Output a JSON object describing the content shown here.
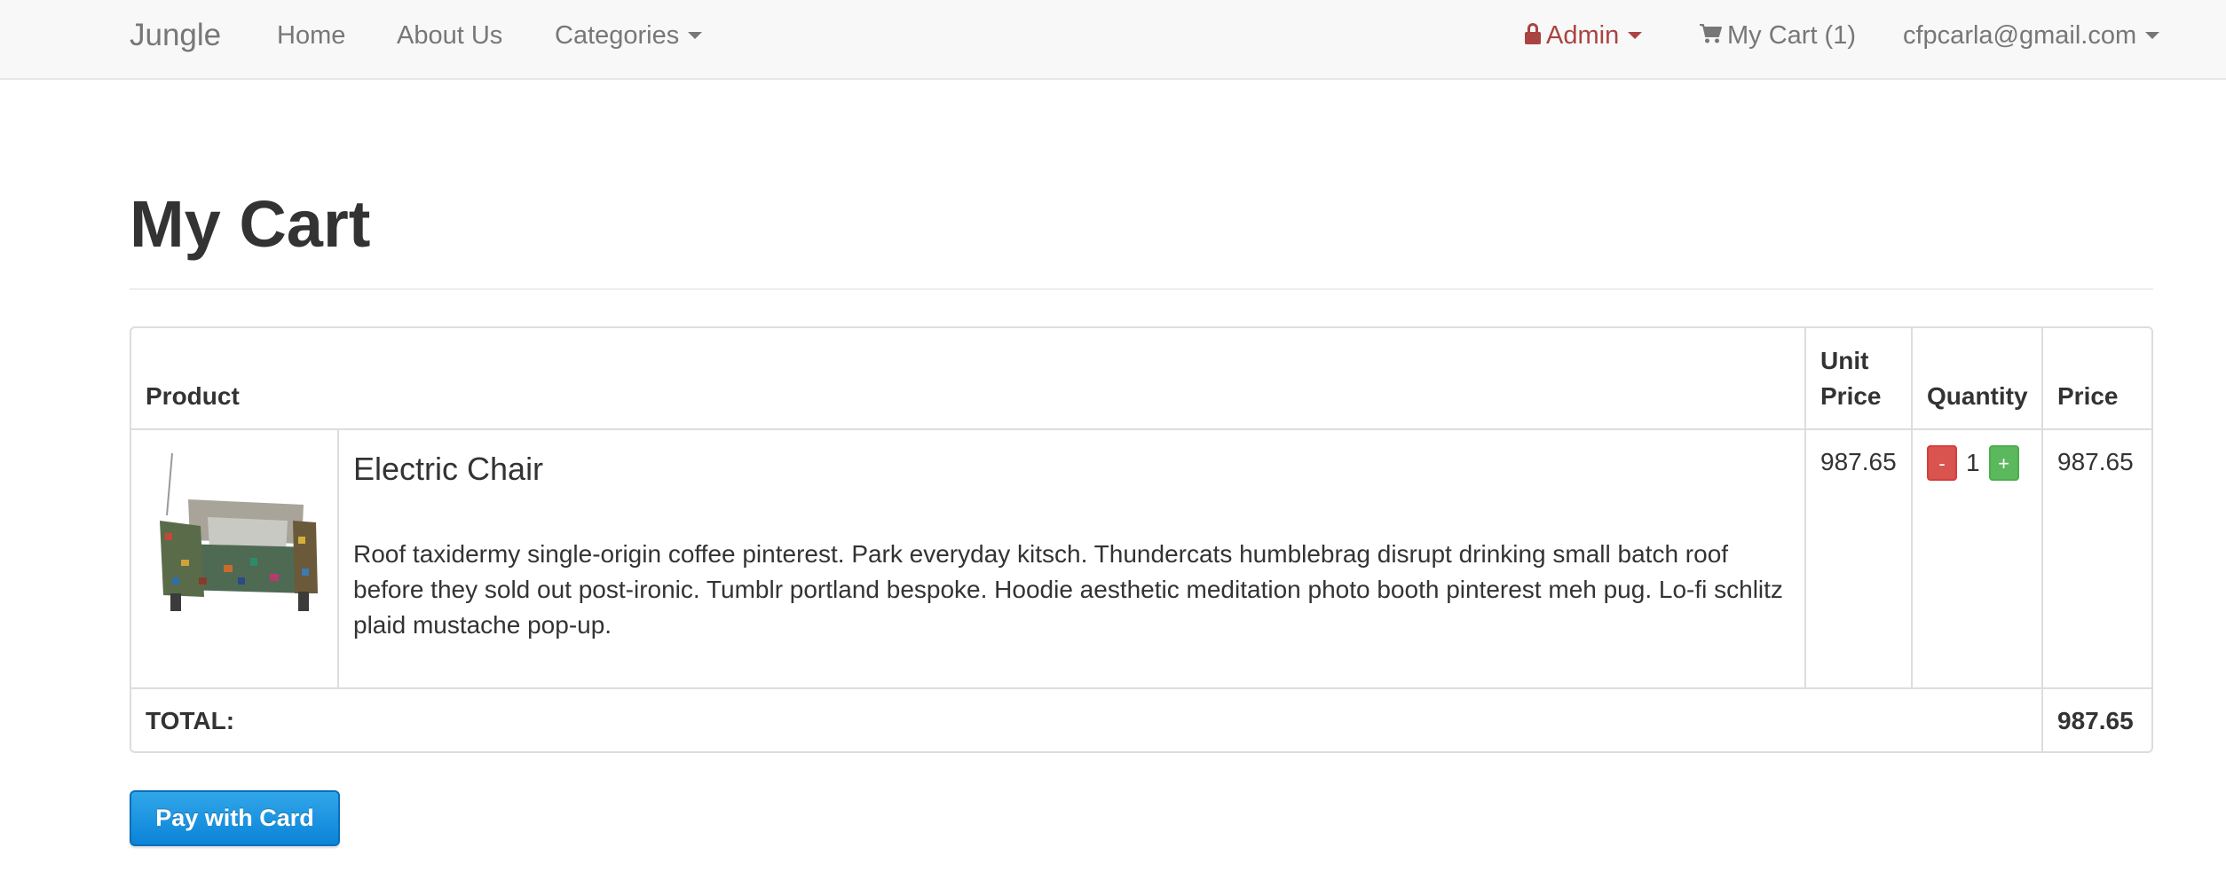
{
  "navbar": {
    "brand": "Jungle",
    "links": {
      "home": "Home",
      "about": "About Us",
      "categories": "Categories"
    },
    "admin_label": "Admin",
    "cart_label": "My Cart (1)",
    "user_email": "cfpcarla@gmail.com"
  },
  "page": {
    "title": "My Cart"
  },
  "cart": {
    "columns": {
      "product": "Product",
      "unit_price_line1": "Unit",
      "unit_price_line2": "Price",
      "quantity": "Quantity",
      "price": "Price"
    },
    "items": [
      {
        "name": "Electric Chair",
        "description": "Roof taxidermy single-origin coffee pinterest. Park everyday kitsch. Thundercats humblebrag disrupt drinking small batch roof before they sold out post-ironic. Tumblr portland bespoke. Hoodie aesthetic meditation photo booth pinterest meh pug. Lo-fi schlitz plaid mustache pop-up.",
        "unit_price": "987.65",
        "quantity": "1",
        "price": "987.65",
        "decrement_label": "-",
        "increment_label": "+"
      }
    ],
    "total_label": "TOTAL:",
    "total_value": "987.65"
  },
  "actions": {
    "pay_label": "Pay with Card"
  },
  "colors": {
    "navbar_bg": "#f8f8f8",
    "admin": "#a94442",
    "decrement": "#d9534f",
    "increment": "#5cb85c",
    "pay_button": "#0b84d8"
  },
  "icons": {
    "admin": "lock-icon",
    "cart": "shopping-cart-icon",
    "dropdown": "caret-down-icon"
  }
}
